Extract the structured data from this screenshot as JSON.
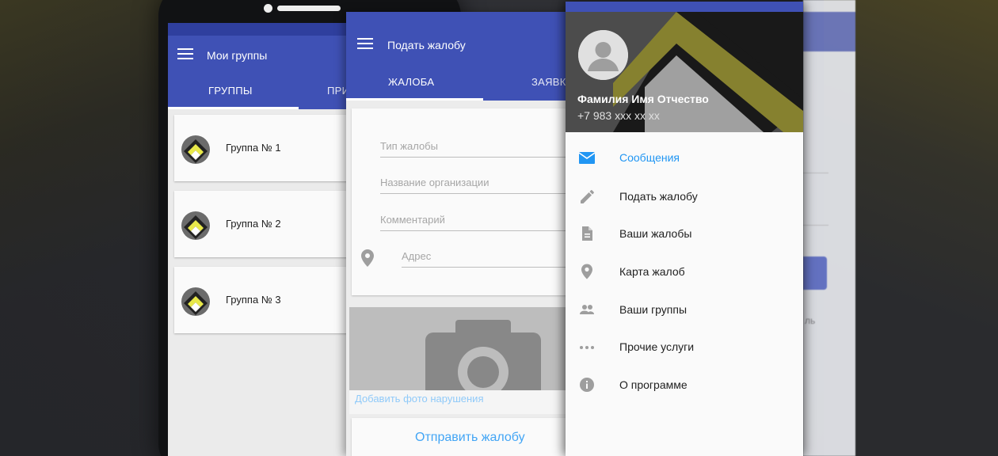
{
  "screen_groups": {
    "title": "Мои группы",
    "tabs": [
      {
        "label": "ГРУППЫ"
      },
      {
        "label": "ПРИ"
      }
    ],
    "groups": [
      {
        "name": "Группа № 1"
      },
      {
        "name": "Группа № 2"
      },
      {
        "name": "Группа № 3"
      }
    ]
  },
  "screen_complaint": {
    "title": "Подать жалобу",
    "tabs": [
      {
        "label": "ЖАЛОБА"
      },
      {
        "label": "ЗАЯВК"
      }
    ],
    "fields": {
      "type_placeholder": "Тип жалобы",
      "organization_placeholder": "Название организации",
      "comment_placeholder": "Комментарий",
      "address_placeholder": "Адрес"
    },
    "photo_caption": "Добавить фото нарушения",
    "submit_label": "Отправить жалобу"
  },
  "drawer": {
    "user_name": "Фамилия Имя Отчество",
    "user_phone": "+7 983 xxx xx xx",
    "items": [
      {
        "label": "Сообщения",
        "icon": "mail-icon",
        "active": true
      },
      {
        "label": "Подать жалобу",
        "icon": "pencil-icon",
        "active": false
      },
      {
        "label": "Ваши жалобы",
        "icon": "document-icon",
        "active": false
      },
      {
        "label": "Карта жалоб",
        "icon": "map-pin-icon",
        "active": false
      },
      {
        "label": "Ваши группы",
        "icon": "people-icon",
        "active": false
      },
      {
        "label": "Прочие услуги",
        "icon": "more-icon",
        "active": false
      },
      {
        "label": "О программе",
        "icon": "info-icon",
        "active": false
      }
    ]
  },
  "background": {
    "partial_text": "ль"
  },
  "colors": {
    "primary": "#3f51b5",
    "accent": "#2196f3",
    "logo_yellow": "#e8e84a"
  }
}
